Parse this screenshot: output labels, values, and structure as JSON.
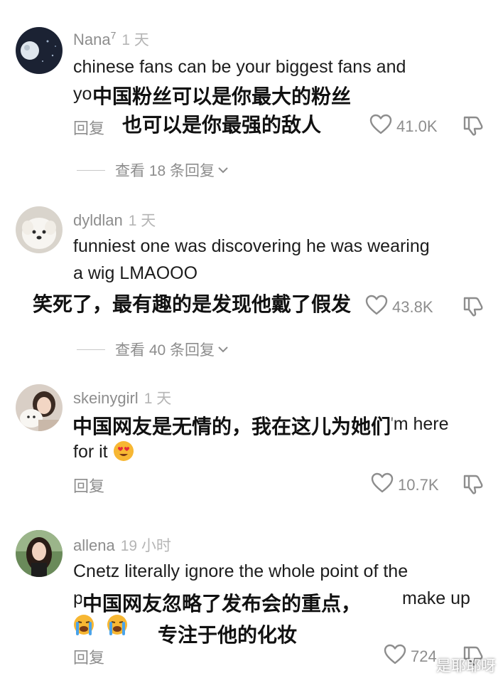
{
  "comments": [
    {
      "username": "Nana",
      "username_sup": "7",
      "time": "1 天",
      "lines": [
        "chinese fans can be your biggest fans and",
        "yo"
      ],
      "overlay_lines": [
        "中国粉丝可以是你最大的粉丝",
        "也可以是你最强的敌人"
      ],
      "reply_label": "回复",
      "likes": "41.0K",
      "view_replies": "查看 18 条回复"
    },
    {
      "username": "dyldlan",
      "time": "1 天",
      "lines": [
        "funniest one was discovering he was wearing",
        "a wig LMAOOO"
      ],
      "overlay_lines": [
        "笑死了，最有趣的是发现他戴了假发"
      ],
      "reply_label": "回复",
      "likes": "43.8K",
      "view_replies": "查看 40 条回复"
    },
    {
      "username": "skeinygirl",
      "time": "1 天",
      "lines": [
        "I'm here",
        "for it"
      ],
      "overlay_lines": [
        "中国网友是无情的，我在这儿为她们"
      ],
      "emoji": "heart-eyes-emoji",
      "reply_label": "回复",
      "likes": "10.7K"
    },
    {
      "username": "allena",
      "time": "19 小时",
      "lines": [
        "Cnetz literally ignore the whole point of the",
        "p",
        "make up"
      ],
      "overlay_lines": [
        "中国网友忽略了发布会的重点，",
        "专注于他的化妆"
      ],
      "emoji": "loudly-crying-emoji",
      "reply_label": "回复",
      "likes": "724"
    }
  ],
  "watermark": "是耶耶呀",
  "icons": {
    "like": "heart-outline-icon",
    "dislike": "thumbs-down-outline-icon",
    "expand": "chevron-down-icon"
  },
  "colors": {
    "text": "#1c1c1c",
    "muted": "#8d8d8d",
    "background": "#ffffff"
  }
}
